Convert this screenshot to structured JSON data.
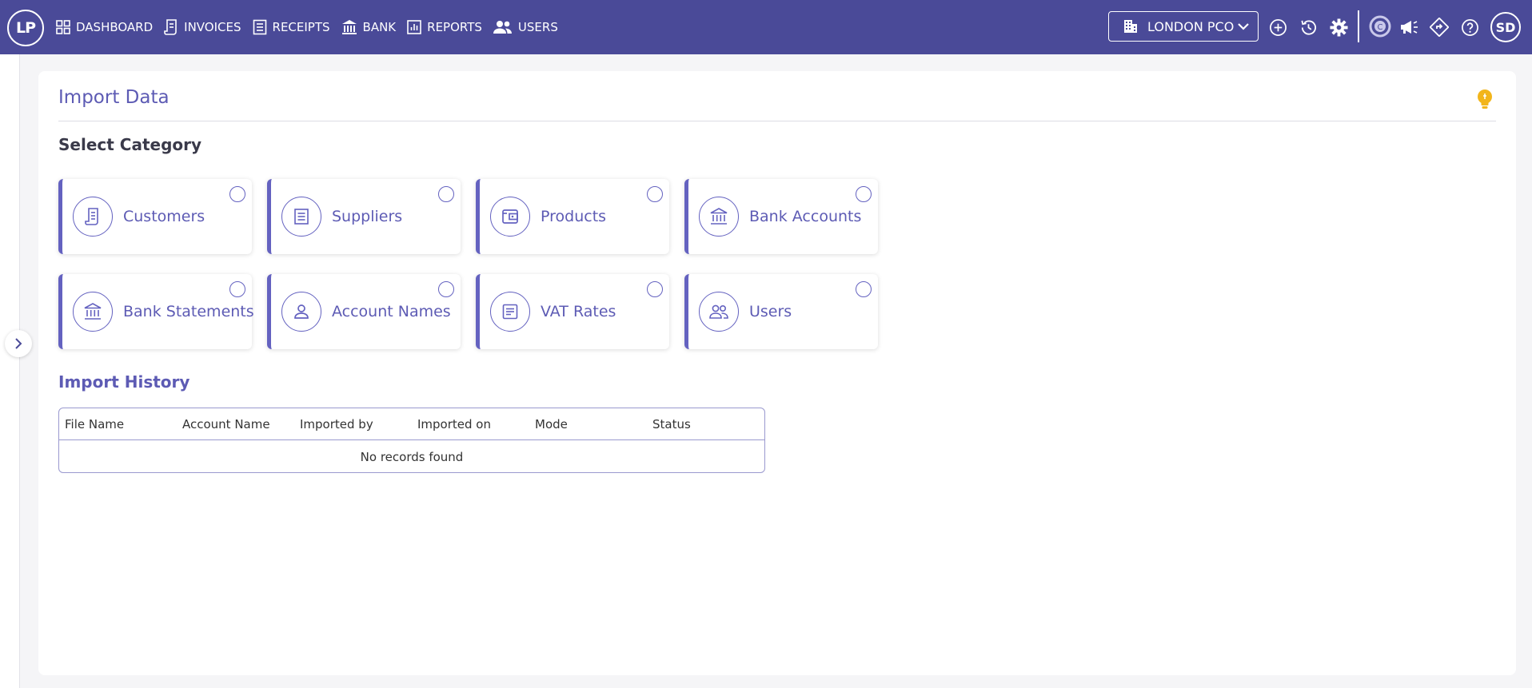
{
  "app": {
    "logo_text": "LP",
    "user_initials": "SD"
  },
  "nav": {
    "items": [
      {
        "label": "DASHBOARD",
        "icon": "dashboard-grid-icon"
      },
      {
        "label": "INVOICES",
        "icon": "invoice-icon"
      },
      {
        "label": "RECEIPTS",
        "icon": "receipt-icon"
      },
      {
        "label": "BANK",
        "icon": "bank-icon"
      },
      {
        "label": "REPORTS",
        "icon": "reports-chart-icon"
      },
      {
        "label": "USERS",
        "icon": "users-icon"
      }
    ]
  },
  "org_selector": {
    "value": "LONDON PCO"
  },
  "toolbar_icons": [
    "add-circle-icon",
    "history-icon",
    "settings-gear-icon",
    "c-brand-icon",
    "announcement-megaphone-icon",
    "diamond-directions-icon",
    "help-question-icon"
  ],
  "page": {
    "title": "Import Data",
    "select_category_heading": "Select Category",
    "categories": [
      {
        "label": "Customers",
        "icon": "customers-document-icon"
      },
      {
        "label": "Suppliers",
        "icon": "suppliers-list-icon"
      },
      {
        "label": "Products",
        "icon": "products-wallet-icon"
      },
      {
        "label": "Bank Accounts",
        "icon": "bank-icon"
      },
      {
        "label": "Bank Statements",
        "icon": "bank-icon"
      },
      {
        "label": "Account Names",
        "icon": "person-icon"
      },
      {
        "label": "VAT Rates",
        "icon": "vat-list-icon"
      },
      {
        "label": "Users",
        "icon": "users-icon"
      }
    ],
    "history_heading": "Import History",
    "table": {
      "columns": [
        "File Name",
        "Account Name",
        "Imported by",
        "Imported on",
        "Mode",
        "Status"
      ],
      "empty_text": "No records found"
    }
  },
  "colors": {
    "topbar": "#4a4a98",
    "accent": "#5d5bb4",
    "tip": "#f2b51b"
  }
}
